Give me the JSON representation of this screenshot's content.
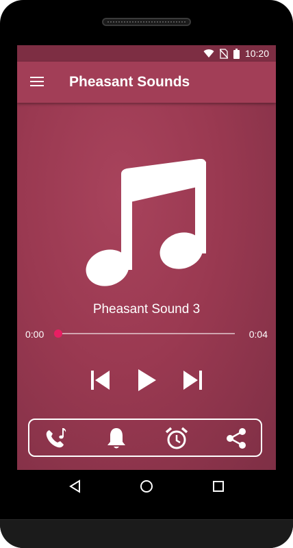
{
  "status_bar": {
    "time": "10:20",
    "icons": [
      "wifi-icon",
      "no-sim-icon",
      "battery-icon"
    ]
  },
  "app_bar": {
    "title": "Pheasant Sounds",
    "menu_icon": "menu-icon"
  },
  "player": {
    "track_title": "Pheasant Sound 3",
    "elapsed": "0:00",
    "duration": "0:04",
    "progress": 0.0,
    "album_art_icon": "music-note-icon",
    "controls": [
      "previous-icon",
      "play-icon",
      "next-icon"
    ]
  },
  "actions": [
    "ringtone-icon",
    "notification-icon",
    "alarm-icon",
    "share-icon"
  ],
  "system_nav": [
    "back-icon",
    "home-icon",
    "recents-icon"
  ],
  "colors": {
    "accent": "#e91e63",
    "app_bar": "#a23e57",
    "status_bar": "#7d2e43",
    "background": "#9a3951"
  }
}
